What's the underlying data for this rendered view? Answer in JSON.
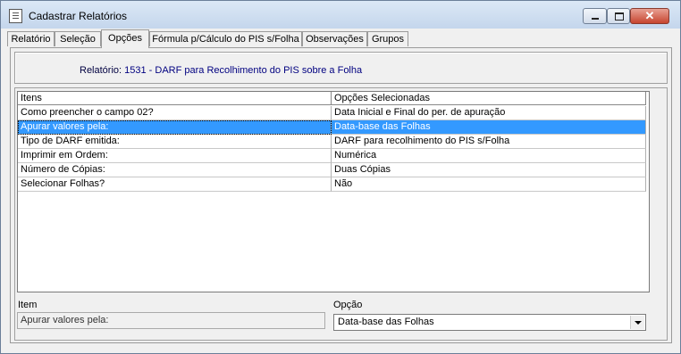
{
  "window": {
    "title": "Cadastrar Relatórios",
    "close_glyph": "✕"
  },
  "tabs": [
    {
      "label": "Relatório"
    },
    {
      "label": "Seleção"
    },
    {
      "label": "Opções",
      "active": true
    },
    {
      "label": "Fórmula p/Cálculo do PIS s/Folha"
    },
    {
      "label": "Observações"
    },
    {
      "label": "Grupos"
    }
  ],
  "report": {
    "label": "Relatório:",
    "value": "1531 - DARF para Recolhimento do PIS sobre a Folha"
  },
  "grid": {
    "columns": [
      "Itens",
      "Opções Selecionadas"
    ],
    "rows": [
      {
        "item": "Como preencher o campo 02?",
        "option": "Data Inicial e Final do per. de apuração"
      },
      {
        "item": "Apurar valores pela:",
        "option": "Data-base das Folhas",
        "selected": true
      },
      {
        "item": "Tipo de DARF emitida:",
        "option": "DARF para recolhimento do PIS s/Folha"
      },
      {
        "item": "Imprimir em Ordem:",
        "option": "Numérica"
      },
      {
        "item": "Número de Cópias:",
        "option": "Duas Cópias"
      },
      {
        "item": "Selecionar Folhas?",
        "option": "Não"
      }
    ]
  },
  "footer": {
    "item_label": "Item",
    "item_value": "Apurar valores pela:",
    "option_label": "Opção",
    "option_value": "Data-base das Folhas"
  },
  "colors": {
    "selection": "#3399ff",
    "report_text": "#000080"
  }
}
